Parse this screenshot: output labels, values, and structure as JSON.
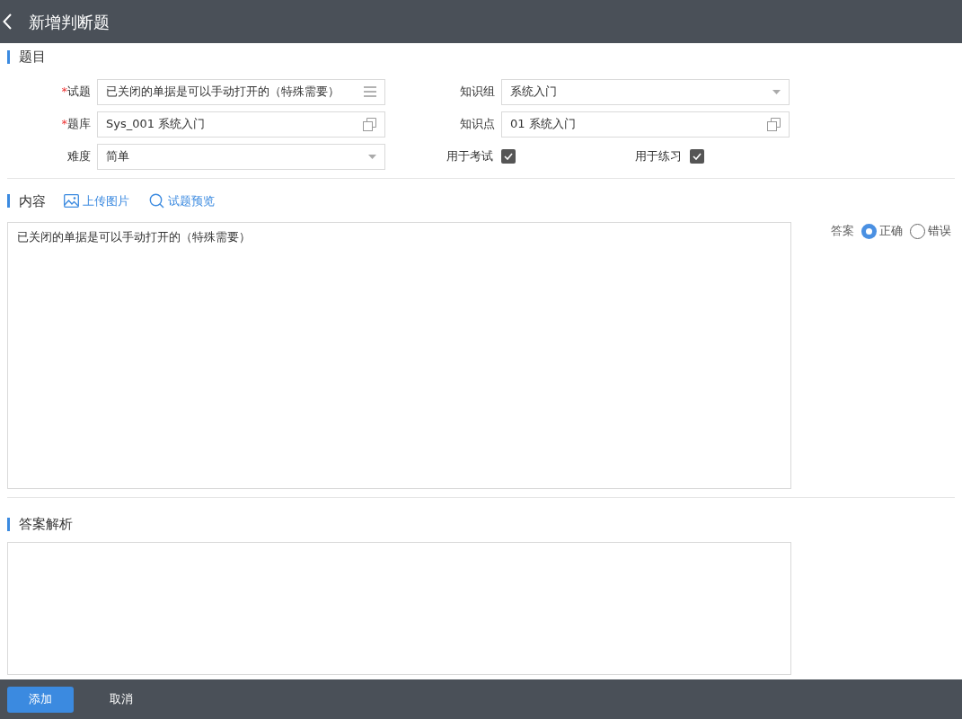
{
  "header": {
    "title": "新增判断题"
  },
  "section_question": {
    "title": "题目",
    "fields": [
      {
        "kind": "text",
        "mark": "*",
        "label": "试题",
        "value": "已关闭的单据是可以手动打开的（特殊需要）"
      },
      {
        "kind": "select",
        "label": "知识组",
        "value": "系统入门"
      },
      {
        "kind": "lookup",
        "mark": "*",
        "label": "题库",
        "value": "Sys_001 系统入门"
      },
      {
        "kind": "lookup",
        "label": "知识点",
        "value": "01 系统入门"
      },
      {
        "kind": "select",
        "label": "难度",
        "value": "简单"
      }
    ],
    "checks": [
      {
        "label": "用于考试",
        "checked": true
      },
      {
        "label": "用于练习",
        "checked": true
      }
    ]
  },
  "section_content": {
    "title": "内容",
    "actions": [
      {
        "kind": "image",
        "label": "上传图片"
      },
      {
        "kind": "search",
        "label": "试题预览"
      }
    ],
    "text": "已关闭的单据是可以手动打开的（特殊需要）",
    "answer": {
      "label": "答案",
      "options": [
        {
          "label": "正确",
          "selected": true
        },
        {
          "label": "错误",
          "selected": false
        }
      ]
    }
  },
  "section_analysis": {
    "title": "答案解析"
  },
  "footer": {
    "buttons": [
      {
        "label": "添加",
        "primary": true
      },
      {
        "label": "取消",
        "primary": false
      }
    ]
  }
}
